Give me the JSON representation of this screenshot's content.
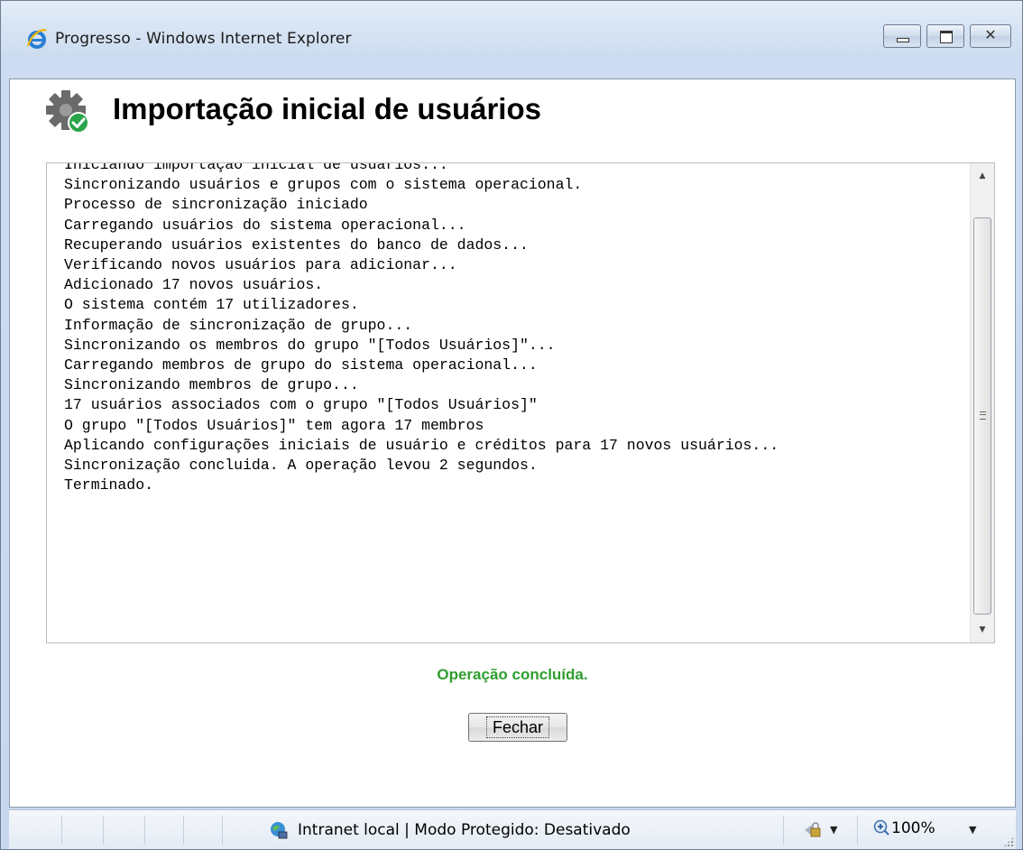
{
  "window": {
    "title": "Progresso - Windows Internet Explorer",
    "icon": "ie-icon",
    "controls": {
      "minimize": "minimize-icon",
      "maximize": "maximize-icon",
      "close": "close-icon"
    }
  },
  "page": {
    "heading": "Importação inicial de usuários",
    "heading_icon": "gear-check-icon",
    "log_lines": [
      "Iniciando importação inicial de usuários...",
      "Sincronizando usuários e grupos com o sistema operacional.",
      "Processo de sincronização iniciado",
      "Carregando usuários do sistema operacional...",
      "Recuperando usuários existentes do banco de dados...",
      "Verificando novos usuários para adicionar...",
      "Adicionado 17 novos usuários.",
      "O sistema contém 17 utilizadores.",
      "Informação de sincronização de grupo...",
      "Sincronizando os membros do grupo \"[Todos Usuários]\"...",
      "Carregando membros de grupo do sistema operacional...",
      "Sincronizando membros de grupo...",
      "17 usuários associados com o grupo \"[Todos Usuários]\"",
      "O grupo \"[Todos Usuários]\" tem agora 17 membros",
      "Aplicando configurações iniciais de usuário e créditos para 17 novos usuários...",
      "Sincronização concluida. A operação levou 2 segundos.",
      "Terminado."
    ],
    "status_message": "Operação concluída.",
    "close_button": "Fechar"
  },
  "statusbar": {
    "zone_text": "Intranet local | Modo Protegido: Desativado",
    "zoom": "100%"
  },
  "colors": {
    "success": "#2e9e2e",
    "titlebar": "#cddcf0"
  }
}
